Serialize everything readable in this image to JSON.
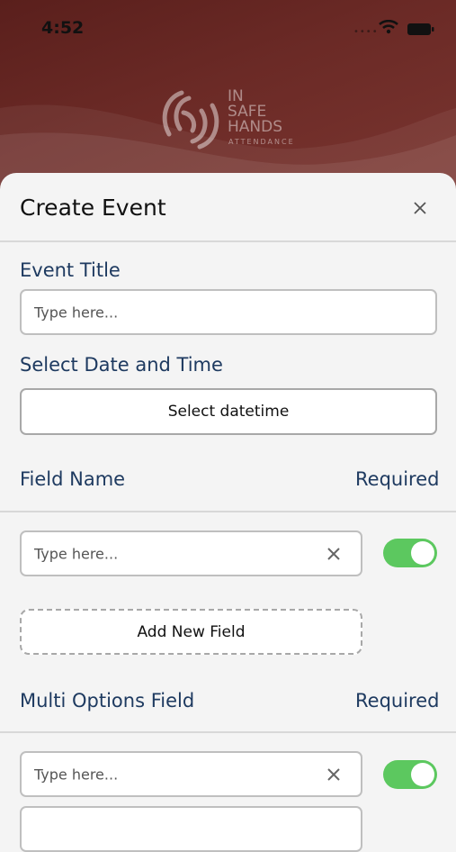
{
  "status_bar": {
    "time": "4:52"
  },
  "brand": {
    "line1": "IN",
    "line2": "SAFE",
    "line3": "HANDS",
    "tagline": "ATTENDANCE"
  },
  "sheet": {
    "title": "Create Event"
  },
  "event_title": {
    "label": "Event Title",
    "placeholder": "Type here..."
  },
  "date_time": {
    "label": "Select Date and Time",
    "button": "Select datetime"
  },
  "fields": {
    "header": "Field Name",
    "required_label": "Required",
    "input_placeholder": "Type here...",
    "required_on": true,
    "add_button": "Add New Field"
  },
  "multi_options": {
    "header": "Multi Options Field",
    "required_label": "Required",
    "input_placeholder": "Type here...",
    "required_on": true
  }
}
